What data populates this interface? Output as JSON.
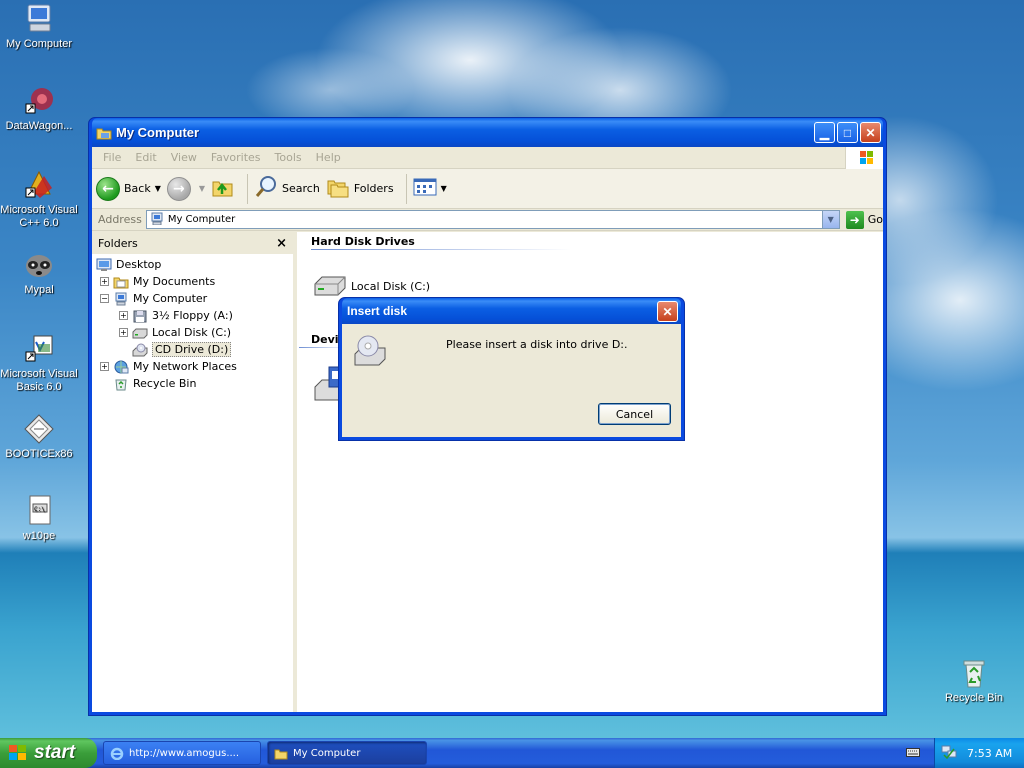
{
  "desktop": {
    "icons": [
      {
        "label": "My Computer",
        "icon": "my-computer-icon"
      },
      {
        "label": "DataWagon...",
        "icon": "datawagon-icon"
      },
      {
        "label": "Microsoft Visual C++ 6.0",
        "icon": "visual-cpp-icon"
      },
      {
        "label": "Mypal",
        "icon": "mypal-icon"
      },
      {
        "label": "Microsoft Visual Basic 6.0",
        "icon": "visual-basic-icon"
      },
      {
        "label": "BOOTICEx86",
        "icon": "bootice-icon"
      },
      {
        "label": "w10pe",
        "icon": "w10pe-icon"
      },
      {
        "label": "Recycle Bin",
        "icon": "recycle-bin-icon"
      }
    ]
  },
  "window": {
    "title": "My Computer",
    "menu": [
      "File",
      "Edit",
      "View",
      "Favorites",
      "Tools",
      "Help"
    ],
    "toolbar": {
      "back": "Back",
      "search": "Search",
      "folders": "Folders"
    },
    "address": {
      "label": "Address",
      "value": "My Computer",
      "go": "Go"
    },
    "folders_pane": {
      "title": "Folders",
      "tree": [
        {
          "label": "Desktop",
          "icon": "desktop-icon",
          "level": 0,
          "expander": ""
        },
        {
          "label": "My Documents",
          "icon": "folder-icon",
          "level": 1,
          "expander": "+"
        },
        {
          "label": "My Computer",
          "icon": "my-computer-icon",
          "level": 1,
          "expander": "−"
        },
        {
          "label": "3½ Floppy (A:)",
          "icon": "floppy-icon",
          "level": 2,
          "expander": "+"
        },
        {
          "label": "Local Disk (C:)",
          "icon": "hard-disk-icon",
          "level": 2,
          "expander": "+"
        },
        {
          "label": "CD Drive (D:)",
          "icon": "cd-drive-icon",
          "level": 2,
          "expander": ""
        },
        {
          "label": "My Network Places",
          "icon": "network-icon",
          "level": 1,
          "expander": "+"
        },
        {
          "label": "Recycle Bin",
          "icon": "recycle-bin-icon",
          "level": 1,
          "expander": ""
        }
      ]
    },
    "main": {
      "section_hdd": "Hard Disk Drives",
      "local_disk": "Local Disk (C:)",
      "section_devices": "Devi"
    }
  },
  "dialog": {
    "title": "Insert disk",
    "message": "Please insert a disk into drive D:.",
    "cancel": "Cancel"
  },
  "taskbar": {
    "start": "start",
    "tasks": [
      {
        "label": "http://www.amogus...."
      },
      {
        "label": "My Computer"
      }
    ],
    "clock": "7:53 AM"
  },
  "colors": {
    "xp_blue": "#0a4ae0",
    "start_green": "#3a9e3a",
    "window_face": "#ece9d8"
  }
}
